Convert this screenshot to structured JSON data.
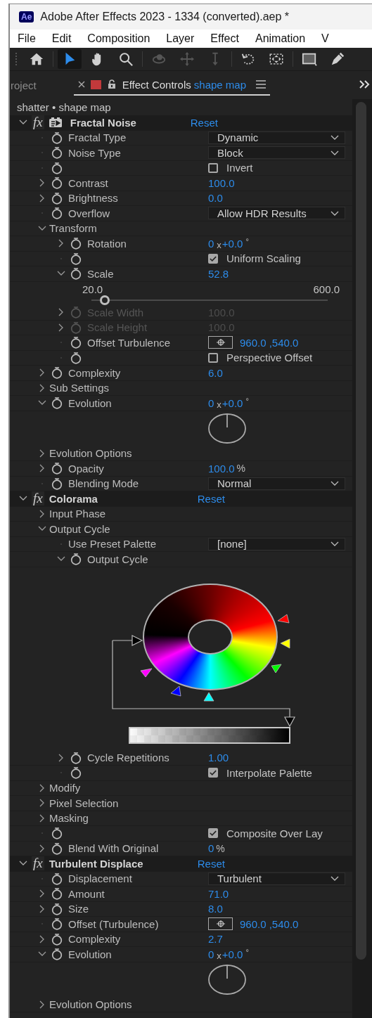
{
  "window": {
    "logo": "Ae",
    "title": "Adobe After Effects 2023 - 1334 (converted).aep *"
  },
  "menu": [
    "File",
    "Edit",
    "Composition",
    "Layer",
    "Effect",
    "Animation",
    "V"
  ],
  "toolbar": [
    {
      "selected": false,
      "disabled": false
    },
    {
      "selected": true,
      "disabled": false
    },
    {
      "selected": false,
      "disabled": false
    },
    {
      "selected": false,
      "disabled": false
    },
    {
      "selected": false,
      "disabled": true
    },
    {
      "selected": false,
      "disabled": true
    },
    {
      "selected": false,
      "disabled": true
    },
    {
      "selected": false,
      "disabled": false
    },
    {
      "selected": false,
      "disabled": false
    },
    {
      "selected": false,
      "disabled": false
    },
    {
      "selected": false,
      "disabled": false
    }
  ],
  "tabs": [
    {
      "label": "roject",
      "selected": false
    },
    {
      "label": "Effect Controls",
      "subject": "shape map",
      "selected": true
    }
  ],
  "breadcrumb": "shatter • shape map",
  "effects": [
    {
      "fx": "fx",
      "name": "Fractal Noise",
      "accelerated": true,
      "expanded": true,
      "reset": "Reset",
      "children": [
        {
          "label": "Fractal Type",
          "stopwatch": true,
          "disabled": false,
          "value": {
            "kind": "dropdown",
            "text": "Dynamic"
          }
        },
        {
          "label": "Noise Type",
          "stopwatch": true,
          "disabled": false,
          "value": {
            "kind": "dropdown",
            "text": "Block"
          }
        },
        {
          "stopwatch": true,
          "disabled": false,
          "value": {
            "kind": "checkbox",
            "checked": false,
            "label": "Invert"
          }
        },
        {
          "label": "Contrast",
          "expanded": false,
          "stopwatch": true,
          "disabled": false,
          "value": {
            "kind": "number",
            "text": "100.0"
          }
        },
        {
          "label": "Brightness",
          "expanded": false,
          "stopwatch": true,
          "disabled": false,
          "value": {
            "kind": "number",
            "text": "0.0"
          }
        },
        {
          "label": "Overflow",
          "stopwatch": true,
          "disabled": false,
          "value": {
            "kind": "dropdown",
            "text": "Allow HDR Results"
          }
        },
        {
          "label": "Transform",
          "expanded": true,
          "stopwatch": false,
          "disabled": false,
          "children": [
            {
              "label": "Rotation",
              "expanded": false,
              "stopwatch": true,
              "disabled": false,
              "value": {
                "kind": "angle",
                "turns": "0",
                "x": "x",
                "degrees": "+0.0",
                "unit": "°"
              }
            },
            {
              "stopwatch": true,
              "disabled": false,
              "value": {
                "kind": "checkbox",
                "checked": true,
                "label": "Uniform Scaling"
              }
            },
            {
              "label": "Scale",
              "expanded": true,
              "stopwatch": true,
              "disabled": false,
              "value": {
                "kind": "number",
                "text": "52.8"
              },
              "slider": {
                "min": "20.0",
                "max": "600.0",
                "level": 0.057
              }
            },
            {
              "label": "Scale Width",
              "expanded": false,
              "stopwatch": true,
              "disabled": true,
              "value": {
                "kind": "number",
                "text": "100.0"
              }
            },
            {
              "label": "Scale Height",
              "expanded": false,
              "stopwatch": true,
              "disabled": true,
              "value": {
                "kind": "number",
                "text": "100.0"
              }
            },
            {
              "label": "Offset Turbulence",
              "stopwatch": true,
              "disabled": false,
              "value": {
                "kind": "point",
                "text": "960.0 ,540.0"
              }
            },
            {
              "stopwatch": true,
              "disabled": false,
              "value": {
                "kind": "checkbox",
                "checked": false,
                "label": "Perspective Offset"
              }
            }
          ]
        },
        {
          "label": "Complexity",
          "expanded": false,
          "stopwatch": true,
          "disabled": false,
          "value": {
            "kind": "number",
            "text": "6.0"
          }
        },
        {
          "label": "Sub Settings",
          "expanded": false,
          "stopwatch": false,
          "disabled": false
        },
        {
          "label": "Evolution",
          "expanded": true,
          "stopwatch": true,
          "disabled": false,
          "value": {
            "kind": "angle",
            "turns": "0",
            "x": "x",
            "degrees": "+0.0",
            "unit": "°"
          }
        },
        {
          "label": "Evolution Options",
          "expanded": false,
          "stopwatch": false,
          "disabled": false
        },
        {
          "label": "Opacity",
          "expanded": false,
          "stopwatch": true,
          "disabled": false,
          "value": {
            "kind": "number",
            "text": "100.0",
            "unit": "%"
          }
        },
        {
          "label": "Blending Mode",
          "stopwatch": true,
          "disabled": false,
          "value": {
            "kind": "dropdown",
            "text": "Normal"
          }
        }
      ]
    },
    {
      "fx": "fx",
      "name": "Colorama",
      "accelerated": false,
      "expanded": true,
      "reset": "Reset",
      "children": [
        {
          "label": "Input Phase",
          "expanded": false,
          "stopwatch": false,
          "disabled": false
        },
        {
          "label": "Output Cycle",
          "expanded": true,
          "stopwatch": false,
          "disabled": false,
          "children": [
            {
              "label": "Use Preset Palette",
              "stopwatch": false,
              "disabled": false,
              "value": {
                "kind": "dropdown",
                "text": "[none]"
              }
            },
            {
              "label": "Output Cycle",
              "expanded": true,
              "stopwatch": true,
              "disabled": false,
              "value": {
                "kind": "palette"
              }
            },
            {
              "label": "Cycle Repetitions",
              "expanded": false,
              "stopwatch": true,
              "disabled": false,
              "value": {
                "kind": "number",
                "text": "1.00"
              }
            },
            {
              "stopwatch": true,
              "disabled": false,
              "value": {
                "kind": "checkbox",
                "checked": true,
                "label": "Interpolate Palette"
              }
            }
          ]
        },
        {
          "label": "Modify",
          "expanded": false,
          "stopwatch": false,
          "disabled": false
        },
        {
          "label": "Pixel Selection",
          "expanded": false,
          "stopwatch": false,
          "disabled": false
        },
        {
          "label": "Masking",
          "expanded": false,
          "stopwatch": false,
          "disabled": false
        },
        {
          "stopwatch": true,
          "disabled": false,
          "value": {
            "kind": "checkbox",
            "checked": true,
            "label": "Composite Over Lay"
          }
        },
        {
          "label": "Blend With Original",
          "expanded": false,
          "stopwatch": true,
          "disabled": false,
          "value": {
            "kind": "number",
            "text": "0",
            "unit": "%"
          }
        }
      ]
    },
    {
      "fx": "fx",
      "name": "Turbulent Displace",
      "accelerated": false,
      "expanded": true,
      "reset": "Reset",
      "children": [
        {
          "label": "Displacement",
          "stopwatch": true,
          "disabled": false,
          "value": {
            "kind": "dropdown",
            "text": "Turbulent"
          }
        },
        {
          "label": "Amount",
          "expanded": false,
          "stopwatch": true,
          "disabled": false,
          "value": {
            "kind": "number",
            "text": "71.0"
          }
        },
        {
          "label": "Size",
          "expanded": false,
          "stopwatch": true,
          "disabled": false,
          "value": {
            "kind": "number",
            "text": "8.0"
          }
        },
        {
          "label": "Offset (Turbulence)",
          "stopwatch": true,
          "disabled": false,
          "value": {
            "kind": "point",
            "text": "960.0 ,540.0"
          }
        },
        {
          "label": "Complexity",
          "expanded": false,
          "stopwatch": true,
          "disabled": false,
          "value": {
            "kind": "number",
            "text": "2.7"
          }
        },
        {
          "label": "Evolution",
          "expanded": true,
          "stopwatch": true,
          "disabled": false,
          "value": {
            "kind": "angle",
            "turns": "0",
            "x": "x",
            "degrees": "+0.0",
            "unit": "°"
          }
        },
        {
          "label": "Evolution Options",
          "expanded": false,
          "stopwatch": false,
          "disabled": false
        }
      ]
    }
  ]
}
